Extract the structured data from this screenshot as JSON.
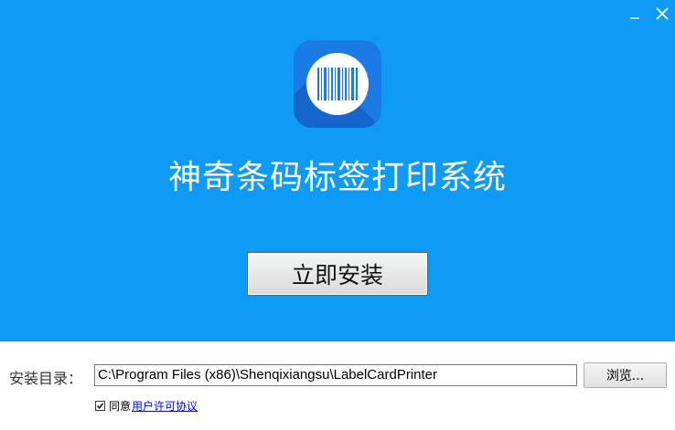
{
  "window": {
    "minimize_icon": "minimize-icon",
    "close_icon": "close-icon"
  },
  "logo": {
    "icon": "barcode-icon"
  },
  "product_title": "神奇条码标签打印系统",
  "install_button": {
    "label": "立即安装"
  },
  "install_dir": {
    "label": "安装目录：",
    "value": "C:\\Program Files (x86)\\Shenqixiangsu\\LabelCardPrinter"
  },
  "browse_button": {
    "label": "浏览..."
  },
  "agreement": {
    "checked": true,
    "text": "同意",
    "link_text": "用户许可协议"
  },
  "colors": {
    "hero_bg": "#0e9bf5",
    "logo_bg": "#1a7ae6",
    "link": "#0000ee"
  }
}
